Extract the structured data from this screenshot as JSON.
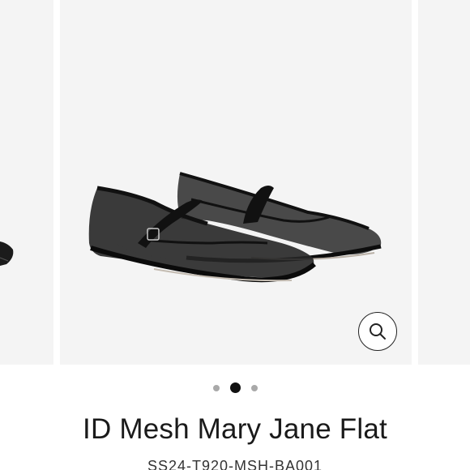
{
  "gallery": {
    "zoom_icon": "magnifier-icon",
    "pagination": {
      "count": 3,
      "active_index": 1
    }
  },
  "product": {
    "title": "ID Mesh Mary Jane Flat",
    "sku": "SS24-T920-MSH-BA001"
  },
  "colors": {
    "panel_bg": "#f4f4f4",
    "shoe_black": "#1b1b1b",
    "dot_active": "#111111",
    "dot_inactive": "#a9a9a9"
  }
}
